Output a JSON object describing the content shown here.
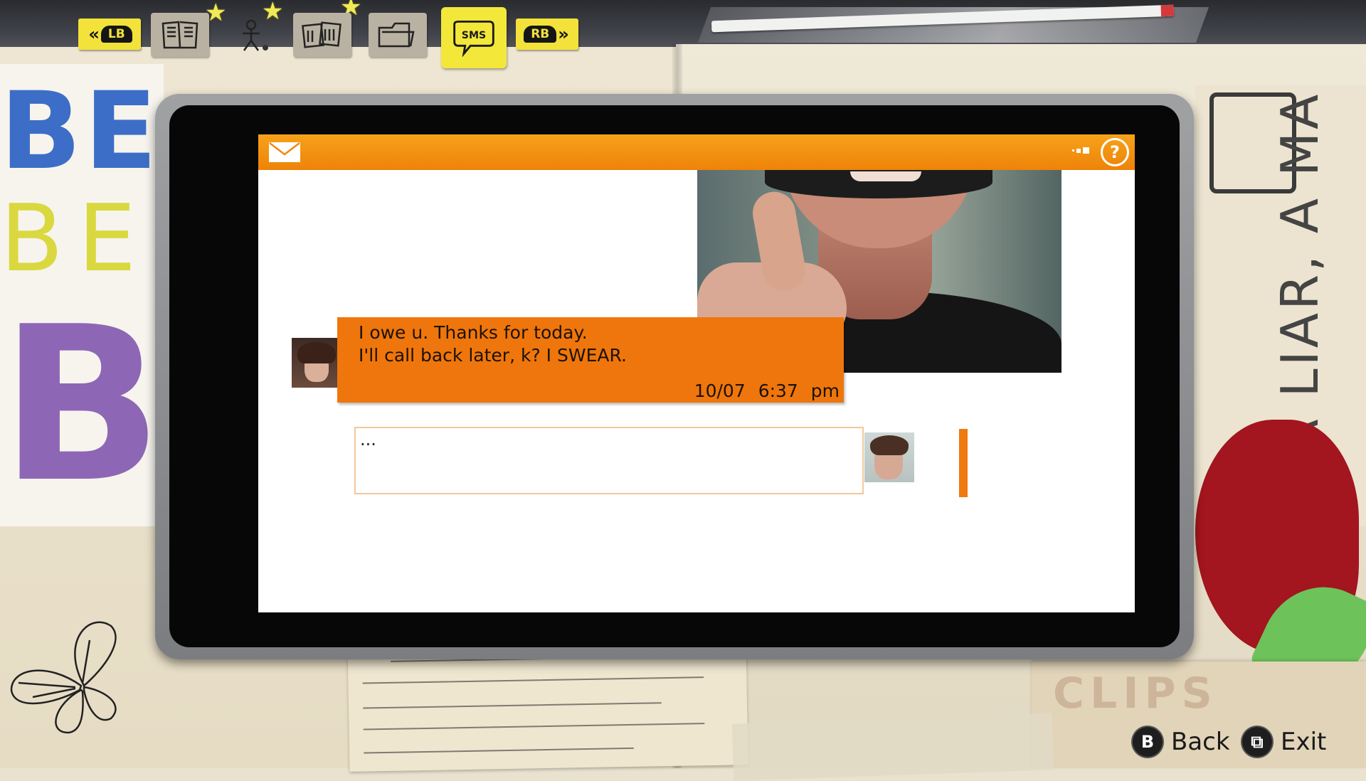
{
  "tabs": {
    "left_bumper": "LB",
    "right_bumper": "RB",
    "items": [
      {
        "name": "journal",
        "icon": "journal-icon"
      },
      {
        "name": "people",
        "icon": "stick-figure-icon"
      },
      {
        "name": "photos",
        "icon": "photos-icon"
      },
      {
        "name": "files",
        "icon": "folder-icon"
      },
      {
        "name": "sms",
        "icon": "sms-speech-bubble-icon",
        "label": "SMS",
        "active": true
      }
    ]
  },
  "phone": {
    "header": {
      "mail_icon": "envelope-icon",
      "signal_icon": "signal-icon",
      "help_label": "?"
    },
    "photo_attachment": {
      "description_icon": "thumbs-up-photo"
    },
    "message": {
      "lines": "I owe u. Thanks for today.\nI'll call back later, k? I SWEAR.",
      "date": "10/07",
      "time": "6:37 pm"
    },
    "reply": {
      "text": "..."
    }
  },
  "footer": {
    "back": {
      "glyph": "B",
      "label": "Back"
    },
    "exit": {
      "glyph": "⧉",
      "label": "Exit"
    }
  },
  "colors": {
    "accent_orange": "#ef760c",
    "tab_yellow": "#f3e73a"
  }
}
